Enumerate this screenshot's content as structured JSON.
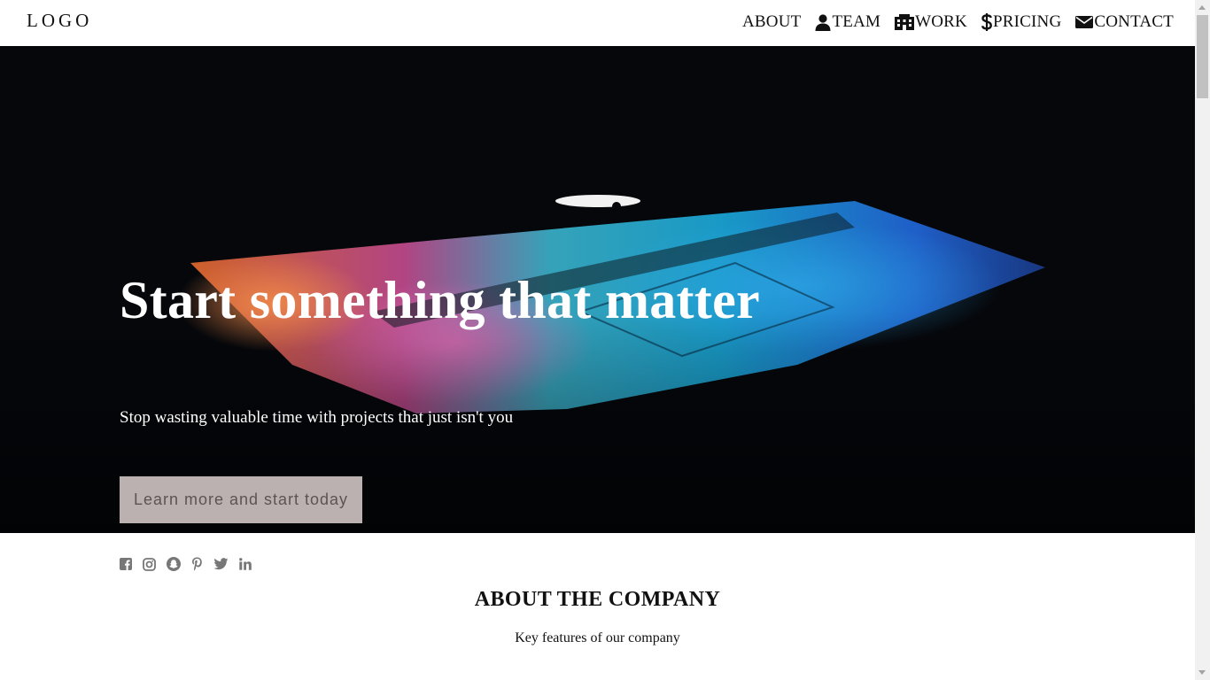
{
  "header": {
    "logo": "LOGO",
    "nav": [
      {
        "label": "ABOUT",
        "icon": ""
      },
      {
        "label": "TEAM",
        "icon": "user-icon"
      },
      {
        "label": "WORK",
        "icon": "building-icon"
      },
      {
        "label": "PRICING",
        "icon": "dollar-icon"
      },
      {
        "label": "CONTACT",
        "icon": "envelope-icon"
      }
    ]
  },
  "hero": {
    "title": "Start something that matter",
    "subtitle": "Stop wasting valuable time with projects that just isn't you",
    "button_label": "Learn more and start today",
    "background_image": "dark laptop with rainbow keyboard glow"
  },
  "social": {
    "icons": [
      "facebook-icon",
      "instagram-icon",
      "snapchat-icon",
      "pinterest-icon",
      "twitter-icon",
      "linkedin-icon"
    ],
    "color": "#777777"
  },
  "about": {
    "title": "ABOUT THE COMPANY",
    "subtitle": "Key features of our company"
  },
  "colors": {
    "hero_bg": "#05070b",
    "button_bg": "#bcb1b1",
    "button_text": "#5d5353",
    "text_dark": "#111111"
  }
}
